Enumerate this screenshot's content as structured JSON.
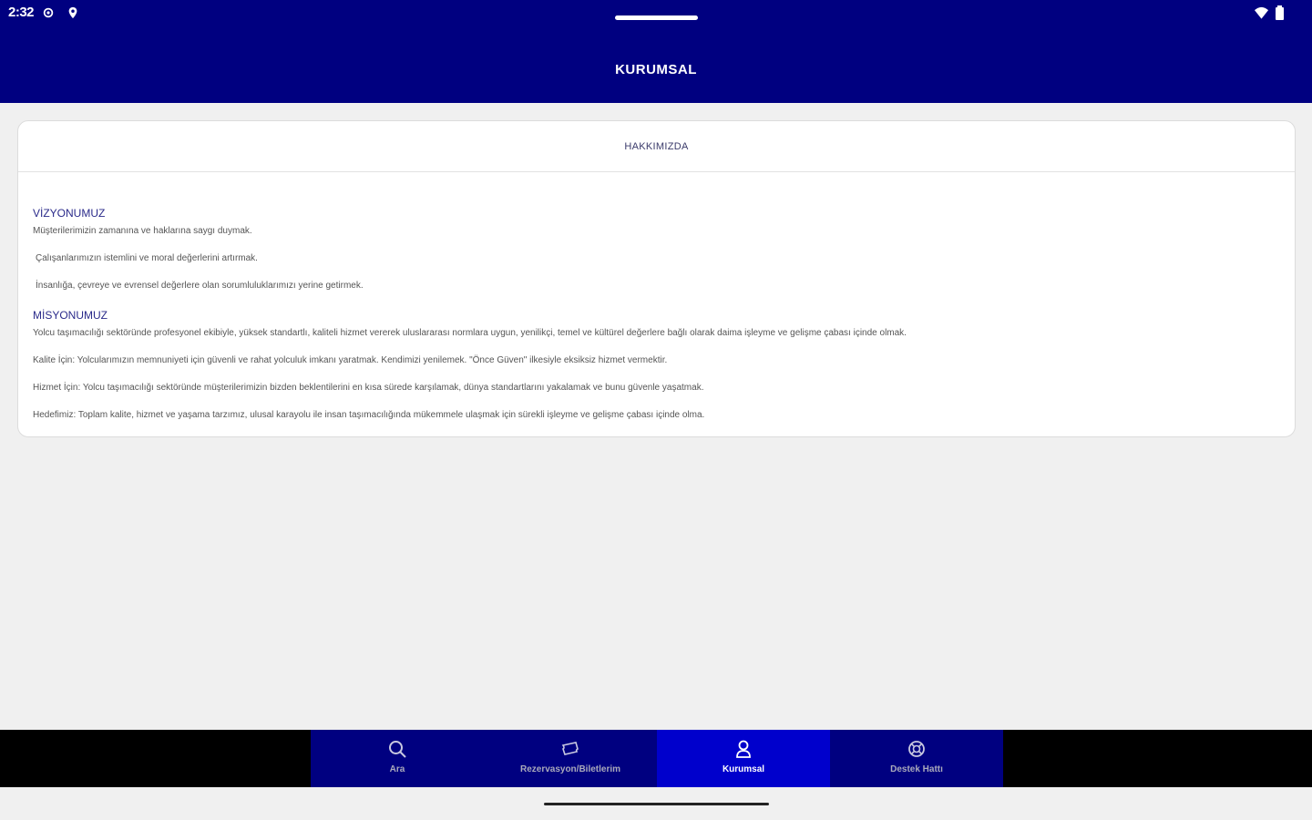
{
  "status_bar": {
    "time": "2:32",
    "icons": [
      "gear-icon",
      "location-icon",
      "wifi-icon",
      "battery-icon"
    ]
  },
  "header": {
    "title": "KURUMSAL"
  },
  "card": {
    "title": "HAKKIMIZDA",
    "sections": [
      {
        "title": "VİZYONUMUZ",
        "lines": [
          "Müşterilerimizin zamanına ve haklarına saygı duymak.",
          " Çalışanlarımızın istemlini ve moral değerlerini artırmak.",
          " İnsanlığa, çevreye ve evrensel değerlere olan sorumluluklarımızı yerine getirmek."
        ]
      },
      {
        "title": "MİSYONUMUZ",
        "lines": [
          "Yolcu taşımacılığı sektöründe profesyonel ekibiyle, yüksek standartlı, kaliteli hizmet vererek uluslararası normlara uygun, yenilikçi, temel ve kültürel değerlere bağlı olarak daima işleyme ve gelişme çabası içinde olmak.",
          "Kalite İçin: Yolcularımızın memnuniyeti için güvenli ve rahat yolculuk imkanı yaratmak. Kendimizi yenilemek. \"Önce Güven\" ilkesiyle eksiksiz hizmet vermektir.",
          "Hizmet İçin: Yolcu taşımacılığı sektöründe müşterilerimizin bizden beklentilerini en kısa sürede karşılamak, dünya standartlarını yakalamak ve bunu güvenle yaşatmak.",
          "Hedefimiz: Toplam kalite, hizmet ve yaşama tarzımız, ulusal karayolu ile insan taşımacılığında mükemmele ulaşmak için sürekli işleyme ve gelişme çabası içinde olma."
        ]
      }
    ]
  },
  "bottom_nav": {
    "items": [
      {
        "label": "Ara",
        "icon": "search-icon",
        "active": false
      },
      {
        "label": "Rezervasyon/Biletlerim",
        "icon": "ticket-icon",
        "active": false
      },
      {
        "label": "Kurumsal",
        "icon": "user-icon",
        "active": true
      },
      {
        "label": "Destek Hattı",
        "icon": "support-icon",
        "active": false
      }
    ]
  },
  "colors": {
    "header_bg": "#000080",
    "nav_active": "#0000cc",
    "nav_bg": "#000080",
    "page_bg": "#f0f0f0"
  }
}
